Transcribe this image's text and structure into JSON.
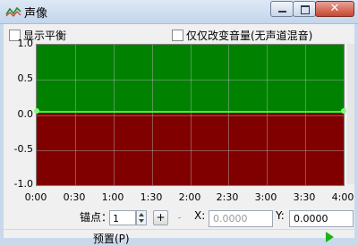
{
  "window": {
    "title": "声像",
    "close_glyph": "✕",
    "icon": "stereo-balance-icon"
  },
  "options": {
    "show_balance": "显示平衡",
    "volume_only": "仅仅改变音量(无声道混音)"
  },
  "chart_data": {
    "type": "area",
    "x_ticks": [
      "0:00",
      "0:30",
      "1:00",
      "1:30",
      "2:00",
      "2:30",
      "3:00",
      "3:30",
      "4:00"
    ],
    "y_ticks": [
      "1.0",
      "0.5",
      "0.0",
      "-0.5",
      "-1.0"
    ],
    "ylim": [
      -1.0,
      1.0
    ],
    "grid": true,
    "series": [
      {
        "points": [
          [
            0,
            0.0
          ],
          [
            4,
            0.0
          ]
        ],
        "color": "#32ff32"
      }
    ],
    "fill_above_color": "#008200",
    "fill_below_color": "#800000"
  },
  "controls": {
    "anchor_label": "锚点：",
    "anchor_value": "1",
    "add_icon": "add-point-icon",
    "remove_icon": "remove-point-icon",
    "x_label": "X:",
    "x_value": "0.0000",
    "y_label": "Y:",
    "y_value": "0.0000",
    "preset_label": "预置(P)"
  }
}
